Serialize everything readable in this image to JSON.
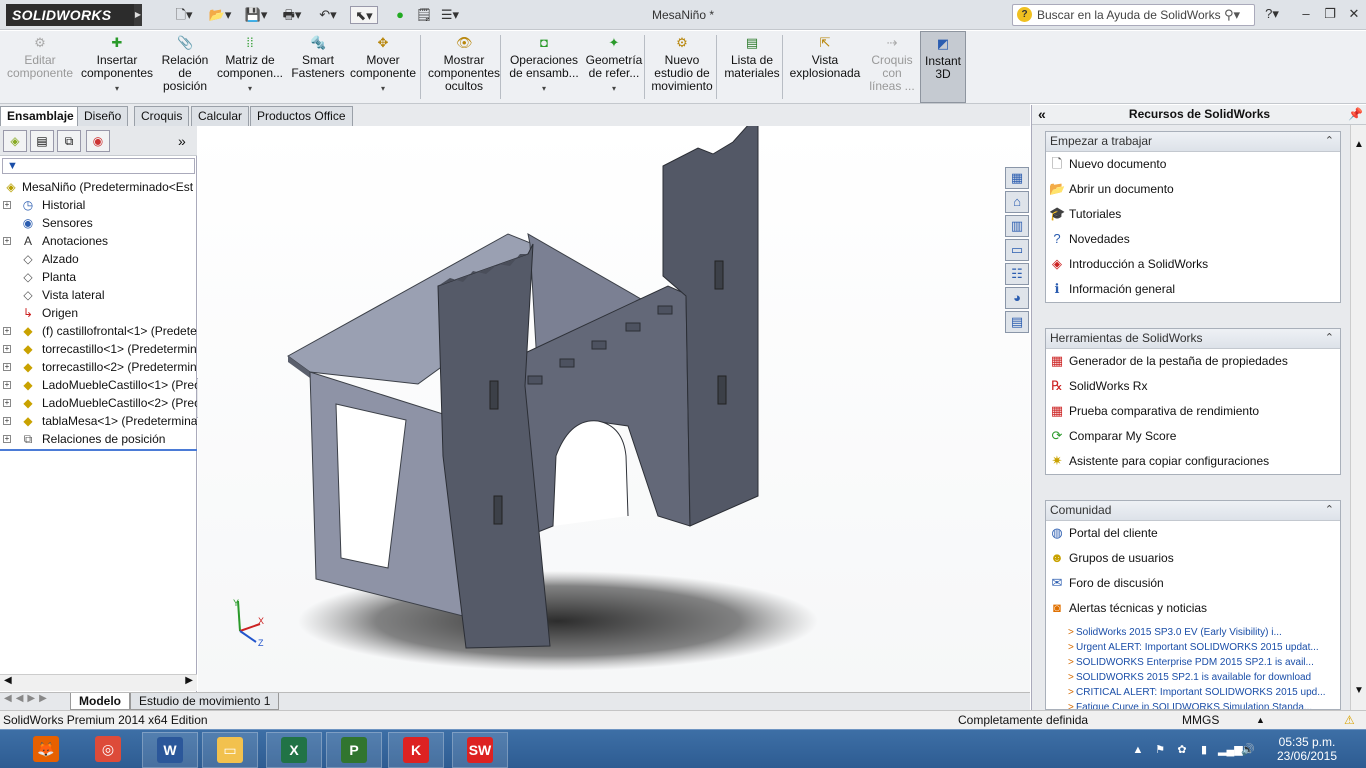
{
  "app": {
    "logo": "SOLIDWORKS",
    "document_title": "MesaNiño *",
    "help_search_placeholder": "Buscar en la Ayuda de SolidWorks"
  },
  "quick_access": [
    "new-icon",
    "open-icon",
    "save-icon",
    "print-icon",
    "undo-icon",
    "select-icon",
    "rebuild-icon",
    "file-properties-icon",
    "options-icon"
  ],
  "commands": [
    {
      "label": "Editar\ncomponente",
      "icon": "edit-component-icon",
      "disabled": true
    },
    {
      "label": "Insertar\ncomponentes",
      "icon": "insert-components-icon",
      "dropdown": true
    },
    {
      "label": "Relación\nde\nposición",
      "icon": "mate-icon"
    },
    {
      "label": "Matriz de\ncomponen...",
      "icon": "pattern-icon",
      "dropdown": true
    },
    {
      "label": "Smart\nFasteners",
      "icon": "smart-fasteners-icon"
    },
    {
      "label": "Mover\ncomponente",
      "icon": "move-component-icon",
      "dropdown": true
    },
    {
      "label": "Mostrar\ncomponentes\nocultos",
      "icon": "show-hidden-icon"
    },
    {
      "label": "Operaciones\nde ensamb...",
      "icon": "assembly-features-icon",
      "dropdown": true
    },
    {
      "label": "Geometría\nde refer...",
      "icon": "reference-geometry-icon",
      "dropdown": true
    },
    {
      "label": "Nuevo\nestudio de\nmovimiento",
      "icon": "motion-study-icon"
    },
    {
      "label": "Lista de\nmateriales",
      "icon": "bom-icon"
    },
    {
      "label": "Vista\nexplosionada",
      "icon": "exploded-view-icon"
    },
    {
      "label": "Croquis\ncon\nlíneas ...",
      "icon": "explode-line-icon",
      "disabled": true
    },
    {
      "label": "Instant\n3D",
      "icon": "instant3d-icon",
      "active": true
    }
  ],
  "cm_tabs": [
    "Ensamblaje",
    "Diseño",
    "Croquis",
    "Calcular",
    "Productos Office"
  ],
  "feature_tree": {
    "filter": "▼",
    "root": "MesaNiño  (Predeterminado<Est",
    "items": [
      {
        "label": "Historial",
        "icon": "history-icon",
        "exp": "+"
      },
      {
        "label": "Sensores",
        "icon": "sensors-icon",
        "exp": ""
      },
      {
        "label": "Anotaciones",
        "icon": "annotations-icon",
        "exp": "+"
      },
      {
        "label": "Alzado",
        "icon": "plane-icon",
        "exp": ""
      },
      {
        "label": "Planta",
        "icon": "plane-icon",
        "exp": ""
      },
      {
        "label": "Vista lateral",
        "icon": "plane-icon",
        "exp": ""
      },
      {
        "label": "Origen",
        "icon": "origin-icon",
        "exp": ""
      },
      {
        "label": "(f) castillofrontal<1> (Predete",
        "icon": "part-icon",
        "exp": "+"
      },
      {
        "label": "torrecastillo<1> (Predetermin",
        "icon": "part-icon",
        "exp": "+"
      },
      {
        "label": "torrecastillo<2> (Predetermin",
        "icon": "part-icon",
        "exp": "+"
      },
      {
        "label": "LadoMuebleCastillo<1> (Prec",
        "icon": "part-icon",
        "exp": "+"
      },
      {
        "label": "LadoMuebleCastillo<2> (Prec",
        "icon": "part-icon",
        "exp": "+"
      },
      {
        "label": "tablaMesa<1> (Predetermina",
        "icon": "part-icon",
        "exp": "+"
      },
      {
        "label": "Relaciones de posición",
        "icon": "mates-icon",
        "exp": "+"
      }
    ]
  },
  "bottom_tabs": [
    "Modelo",
    "Estudio de movimiento 1"
  ],
  "status": {
    "edition": "SolidWorks Premium 2014 x64 Edition",
    "state": "Completamente definida",
    "units": "MMGS"
  },
  "task_pane": {
    "title": "Recursos de SolidWorks",
    "panels": [
      {
        "title": "Empezar a trabajar",
        "items": [
          {
            "label": "Nuevo documento",
            "icon": "new-document-icon"
          },
          {
            "label": "Abrir un documento",
            "icon": "open-document-icon"
          },
          {
            "label": "Tutoriales",
            "icon": "tutorials-icon"
          },
          {
            "label": "Novedades",
            "icon": "whats-new-icon"
          },
          {
            "label": "Introducción a SolidWorks",
            "icon": "intro-icon"
          },
          {
            "label": "Información general",
            "icon": "info-icon"
          }
        ]
      },
      {
        "title": "Herramientas de SolidWorks",
        "items": [
          {
            "label": "Generador de la pestaña de propiedades",
            "icon": "property-tab-icon"
          },
          {
            "label": "SolidWorks Rx",
            "icon": "rx-icon"
          },
          {
            "label": "Prueba comparativa de rendimiento",
            "icon": "benchmark-icon"
          },
          {
            "label": "Comparar My Score",
            "icon": "compare-score-icon"
          },
          {
            "label": "Asistente para copiar configuraciones",
            "icon": "copy-settings-icon"
          }
        ]
      },
      {
        "title": "Comunidad",
        "items": [
          {
            "label": "Portal del cliente",
            "icon": "customer-portal-icon"
          },
          {
            "label": "Grupos de usuarios",
            "icon": "user-groups-icon"
          },
          {
            "label": "Foro de discusión",
            "icon": "forum-icon"
          },
          {
            "label": "Alertas técnicas y noticias",
            "icon": "rss-icon"
          }
        ],
        "news": [
          "SolidWorks 2015 SP3.0 EV (Early Visibility) i...",
          "Urgent ALERT: Important SOLIDWORKS 2015 updat...",
          "SOLIDWORKS Enterprise PDM 2015 SP2.1 is avail...",
          "SOLIDWORKS 2015 SP2.1 is available for download",
          "CRITICAL ALERT: Important SOLIDWORKS 2015 upd...",
          "Fatigue Curve in SOLIDWORKS Simulation Standa..."
        ]
      }
    ]
  },
  "taskbar": {
    "apps": [
      "firefox-icon",
      "chrome-icon",
      "word-icon",
      "file-explorer-icon",
      "excel-icon",
      "project-icon",
      "kaspersky-icon",
      "solidworks-icon"
    ],
    "time": "05:35 p.m.",
    "date": "23/06/2015"
  },
  "colors": {
    "part_fill": "#555a66",
    "part_face": "#8d92a4",
    "brand_red": "#d22"
  }
}
